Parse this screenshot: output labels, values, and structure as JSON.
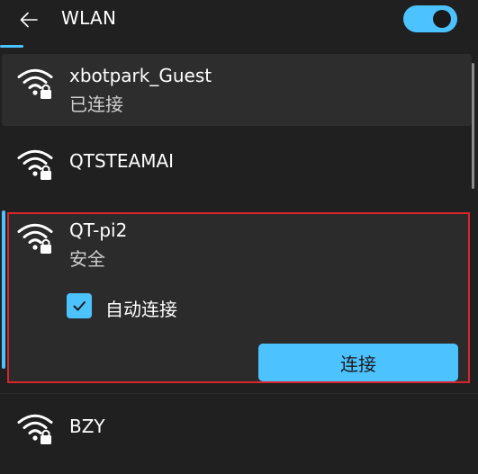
{
  "header": {
    "back_icon": "arrow-left-icon",
    "title": "WLAN",
    "toggle_state": "on",
    "accent_color": "#4cc2ff"
  },
  "networks": [
    {
      "name": "xbotpark_Guest",
      "status": "已连接",
      "icon": "wifi-secured-icon"
    },
    {
      "name": "QTSTEAMAI",
      "status": "",
      "icon": "wifi-secured-icon"
    },
    {
      "name": "QT-pi2",
      "status": "安全",
      "icon": "wifi-secured-icon",
      "auto_connect_label": "自动连接",
      "auto_connect_checked": true,
      "connect_label": "连接",
      "highlight_color": "#d9262c"
    },
    {
      "name": "BZY",
      "status": "",
      "icon": "wifi-secured-icon"
    }
  ]
}
